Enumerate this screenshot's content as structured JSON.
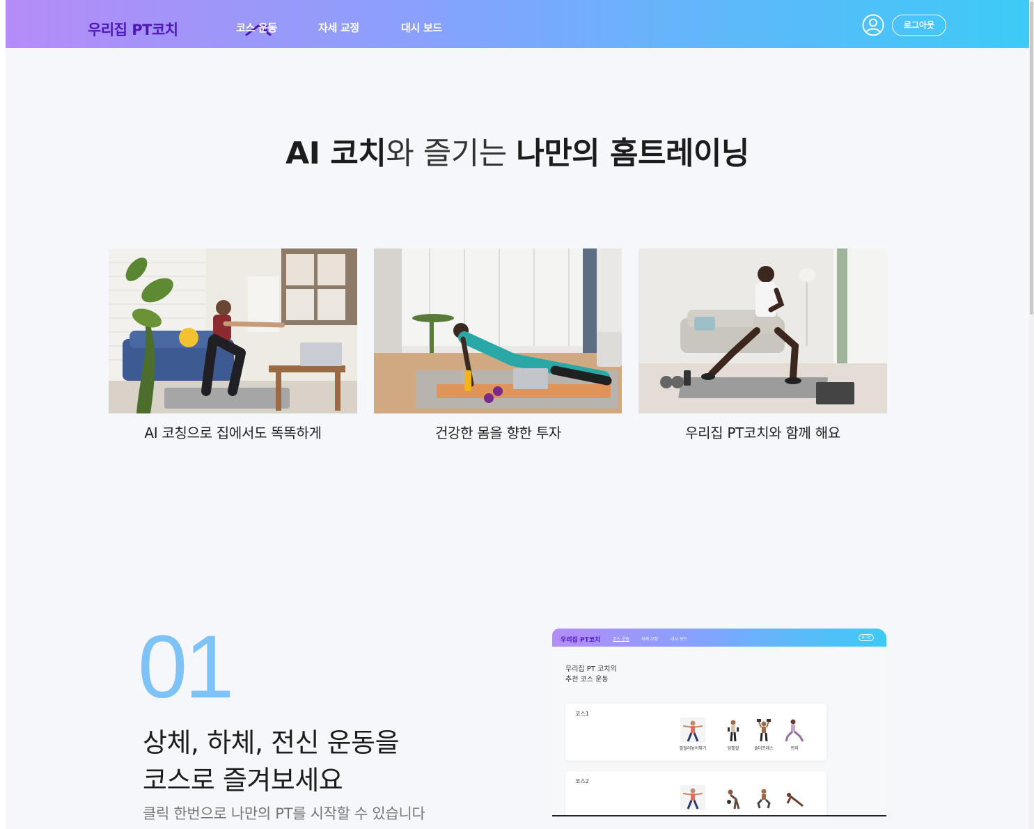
{
  "nav": {
    "logo": "우리집 PT코치",
    "links": [
      "코스 운동",
      "자세 교정",
      "대시 보드"
    ],
    "logout_label": "로그아웃"
  },
  "hero": {
    "title_parts": [
      "AI 코치",
      "와 즐기는 ",
      "나만의 홈트레이닝"
    ]
  },
  "cards": [
    {
      "caption": "AI 코칭으로 집에서도 똑똑하게",
      "image": "woman-squat-photo"
    },
    {
      "caption": "건강한 몸을 향한 투자",
      "image": "woman-side-plank-photo"
    },
    {
      "caption": "우리집 PT코치와 함께 해요",
      "image": "man-lunge-photo"
    }
  ],
  "feature": {
    "number": "01",
    "title_line1": "상체, 하체, 전신 운동을",
    "title_line2": "코스로 즐겨보세요",
    "subtitle": "클릭 한번으로 나만의 PT를 시작할 수 있습니다"
  },
  "preview": {
    "logo": "우리집 PT코치",
    "links": [
      "코스 운동",
      "자세 교정",
      "대시 보드"
    ],
    "logout_label": "로그인",
    "heading_line1": "우리집 PT 코치의",
    "heading_line2": "추천 코스 운동",
    "courses": [
      {
        "title": "코스1",
        "exercises": [
          "팔벌려높이뛰기",
          "덤벨컬",
          "숄더프레스",
          "런지"
        ]
      },
      {
        "title": "코스2",
        "exercises": [
          "",
          "",
          "",
          ""
        ]
      }
    ]
  },
  "colors": {
    "accent": "#7ec3f7",
    "logo": "#4f16b8",
    "nav_gradient_start": "#b58cf8",
    "nav_gradient_end": "#3dcbf6"
  }
}
